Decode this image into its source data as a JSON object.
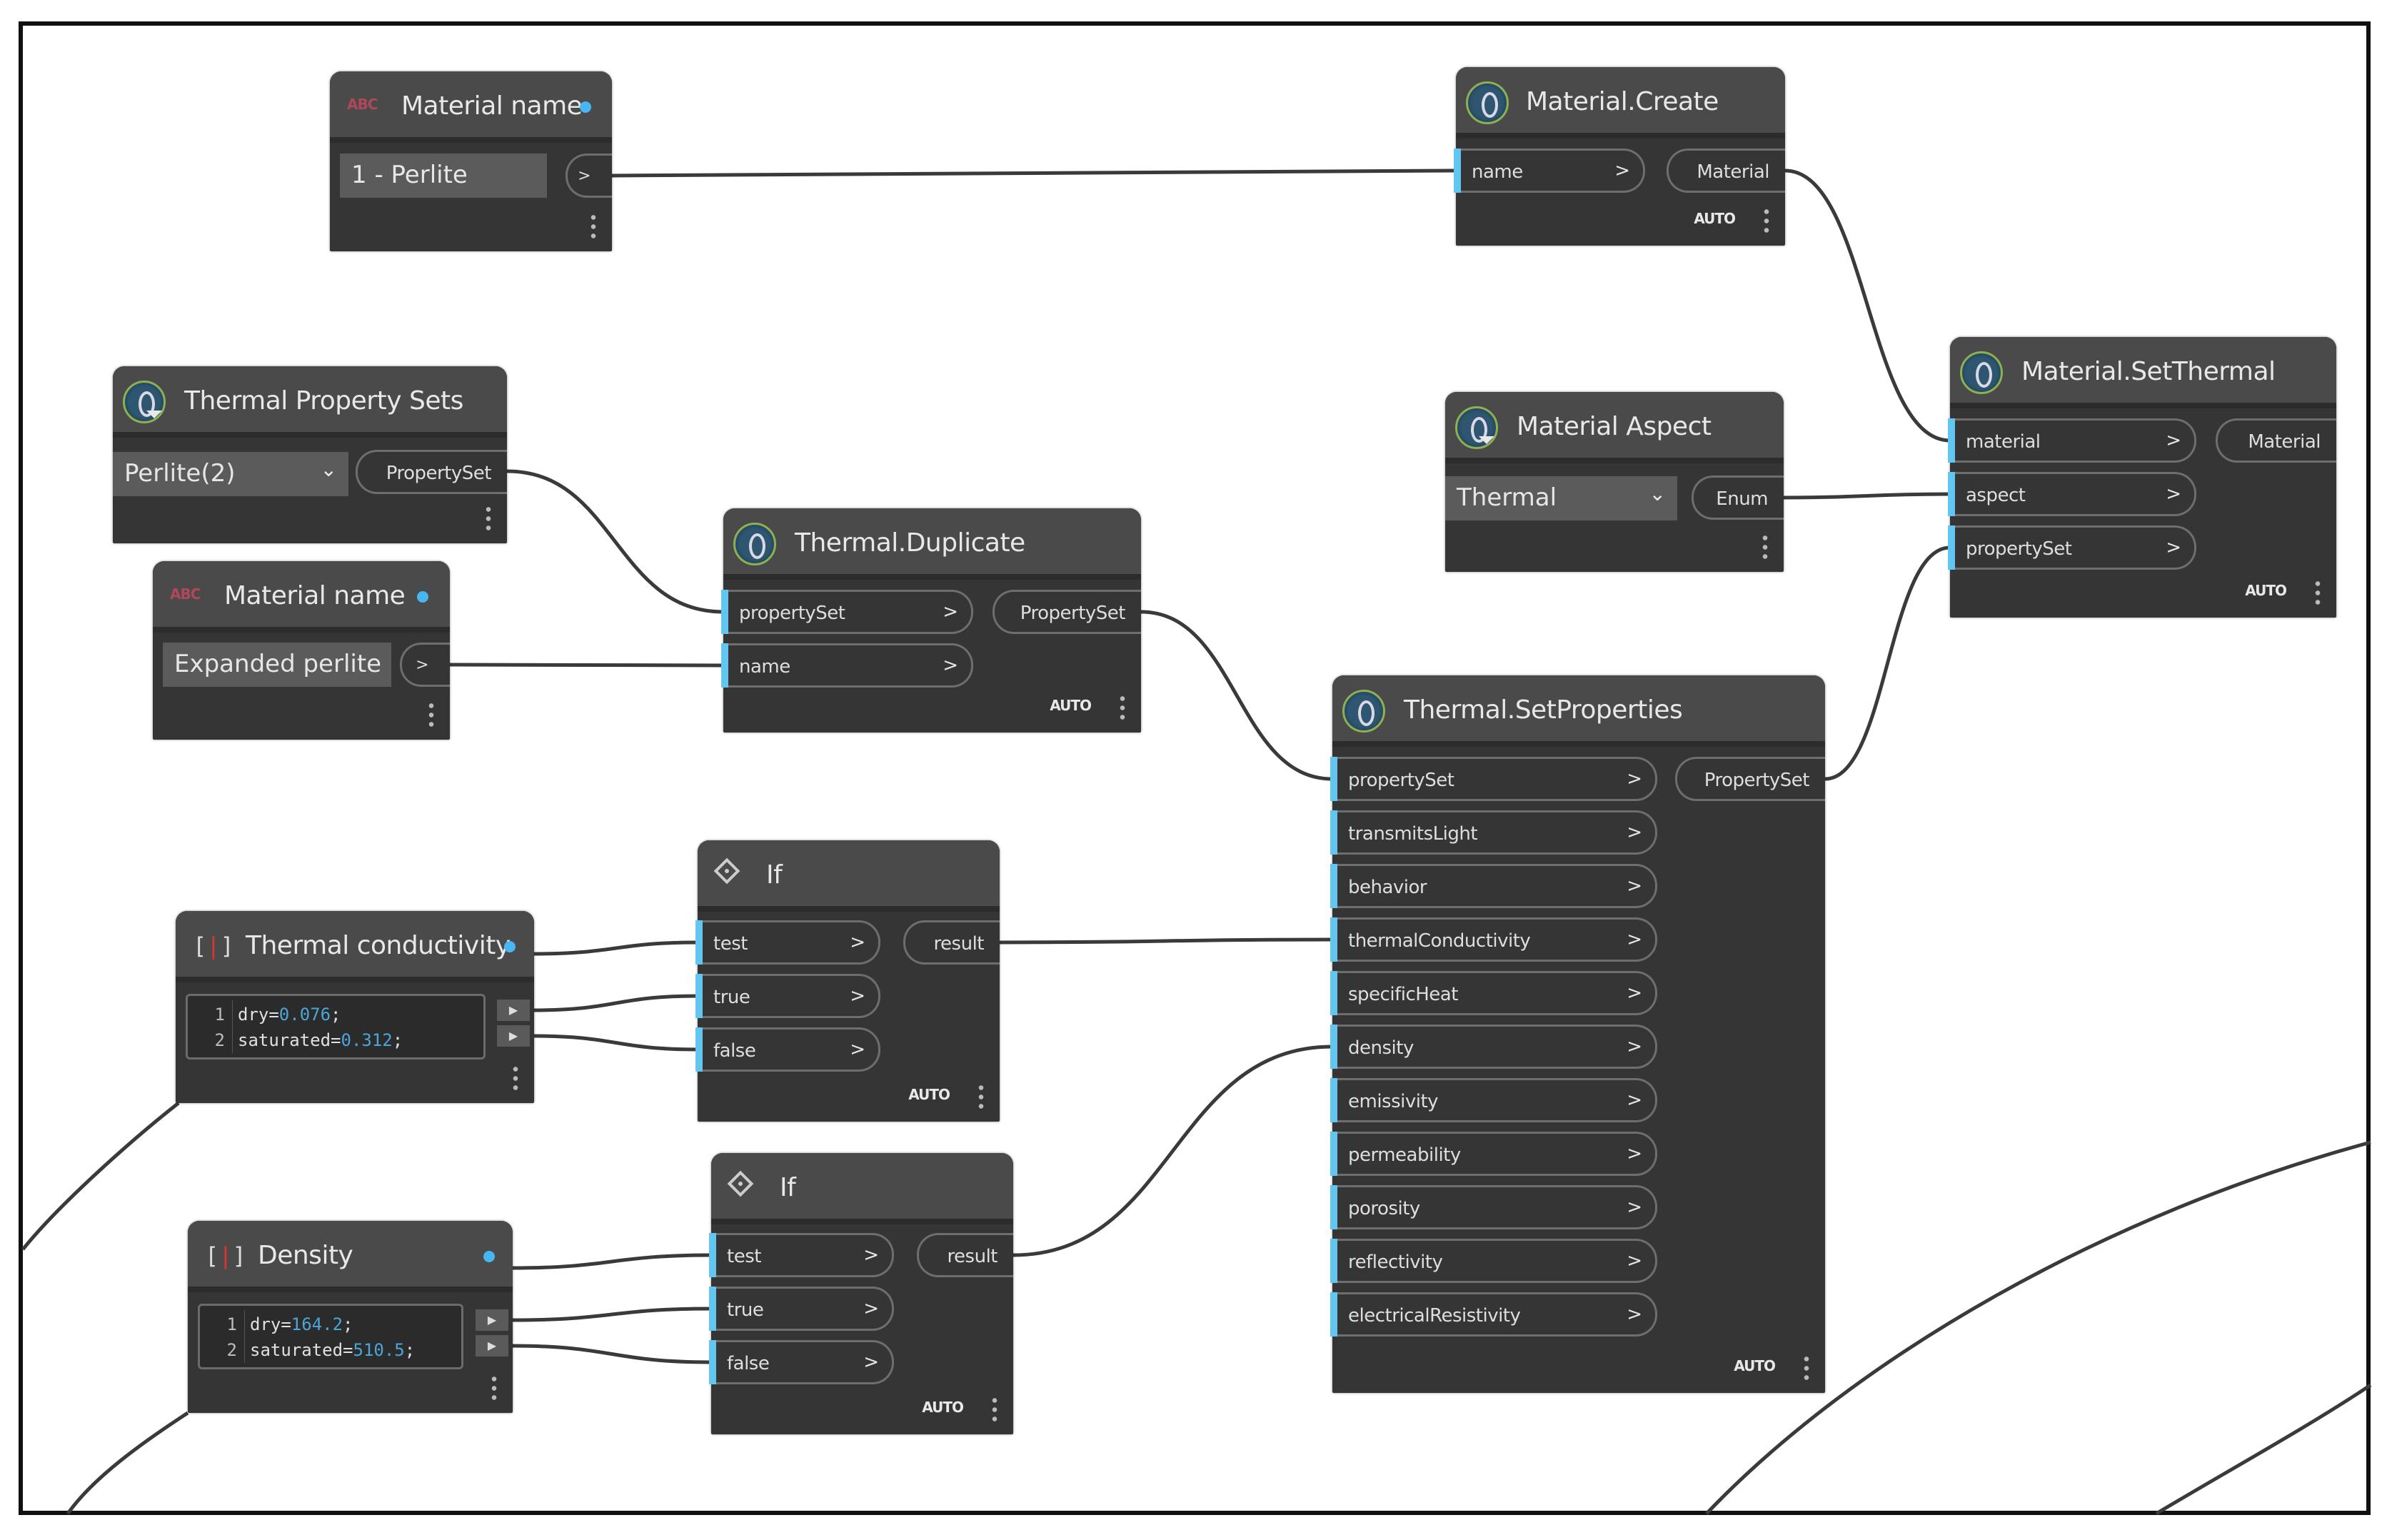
{
  "canvas": {
    "background": "#ffffff",
    "node_color": "#353535",
    "port_accent": "#63c6f0",
    "wire_color": "#3a3a3a"
  },
  "nodes": {
    "material_name_1": {
      "title": "Material name",
      "icon": "abc-string-icon",
      "value": "1 - Perlite",
      "output_chevron": ">"
    },
    "material_create": {
      "title": "Material.Create",
      "inputs": [
        {
          "label": "name",
          "chevron": ">"
        }
      ],
      "output": "Material",
      "lacing": "AUTO"
    },
    "thermal_property_sets": {
      "title": "Thermal Property Sets",
      "selected": "Perlite(2)",
      "dropdown_icon": "⌄",
      "output": "PropertySet"
    },
    "material_name_2": {
      "title": "Material name",
      "icon": "abc-string-icon",
      "value": "Expanded perlite",
      "output_chevron": ">"
    },
    "thermal_duplicate": {
      "title": "Thermal.Duplicate",
      "inputs": [
        {
          "label": "propertySet",
          "chevron": ">"
        },
        {
          "label": "name",
          "chevron": ">"
        }
      ],
      "output": "PropertySet",
      "lacing": "AUTO"
    },
    "material_aspect": {
      "title": "Material Aspect",
      "selected": "Thermal",
      "dropdown_icon": "⌄",
      "output": "Enum"
    },
    "material_setthermal": {
      "title": "Material.SetThermal",
      "inputs": [
        {
          "label": "material",
          "chevron": ">"
        },
        {
          "label": "aspect",
          "chevron": ">"
        },
        {
          "label": "propertySet",
          "chevron": ">"
        }
      ],
      "output": "Material",
      "lacing": "AUTO"
    },
    "thermal_setproperties": {
      "title": "Thermal.SetProperties",
      "inputs": [
        {
          "label": "propertySet",
          "chevron": ">"
        },
        {
          "label": "transmitsLight",
          "chevron": ">"
        },
        {
          "label": "behavior",
          "chevron": ">"
        },
        {
          "label": "thermalConductivity",
          "chevron": ">"
        },
        {
          "label": "specificHeat",
          "chevron": ">"
        },
        {
          "label": "density",
          "chevron": ">"
        },
        {
          "label": "emissivity",
          "chevron": ">"
        },
        {
          "label": "permeability",
          "chevron": ">"
        },
        {
          "label": "porosity",
          "chevron": ">"
        },
        {
          "label": "reflectivity",
          "chevron": ">"
        },
        {
          "label": "electricalResistivity",
          "chevron": ">"
        }
      ],
      "output": "PropertySet",
      "lacing": "AUTO"
    },
    "thermal_conductivity": {
      "title": "Thermal conductivity",
      "code": [
        {
          "n": "1",
          "key": "dry=",
          "num": "0.076",
          "end": ";"
        },
        {
          "n": "2",
          "key": "saturated=",
          "num": "0.312",
          "end": ";"
        }
      ],
      "output_chevron": "▶"
    },
    "density": {
      "title": "Density",
      "code": [
        {
          "n": "1",
          "key": "dry=",
          "num": "164.2",
          "end": ";"
        },
        {
          "n": "2",
          "key": "saturated=",
          "num": "510.5",
          "end": ";"
        }
      ],
      "output_chevron": "▶"
    },
    "if_1": {
      "title": "If",
      "inputs": [
        {
          "label": "test",
          "chevron": ">"
        },
        {
          "label": "true",
          "chevron": ">"
        },
        {
          "label": "false",
          "chevron": ">"
        }
      ],
      "output": "result",
      "lacing": "AUTO"
    },
    "if_2": {
      "title": "If",
      "inputs": [
        {
          "label": "test",
          "chevron": ">"
        },
        {
          "label": "true",
          "chevron": ">"
        },
        {
          "label": "false",
          "chevron": ">"
        }
      ],
      "output": "result",
      "lacing": "AUTO"
    }
  },
  "connections": [
    {
      "from": "material_name_1.out",
      "to": "material_create.in0"
    },
    {
      "from": "material_create.out",
      "to": "material_setthermal.in0"
    },
    {
      "from": "material_aspect.out",
      "to": "material_setthermal.in1"
    },
    {
      "from": "thermal_setproperties.out",
      "to": "material_setthermal.in2"
    },
    {
      "from": "thermal_property_sets.out",
      "to": "thermal_duplicate.in0"
    },
    {
      "from": "material_name_2.out",
      "to": "thermal_duplicate.in1"
    },
    {
      "from": "thermal_duplicate.out",
      "to": "thermal_setproperties.in0"
    },
    {
      "from": "if_1.out",
      "to": "thermal_setproperties.in3"
    },
    {
      "from": "if_2.out",
      "to": "thermal_setproperties.in5"
    },
    {
      "from": "thermal_conductivity.hdr",
      "to": "if_1.in0"
    },
    {
      "from": "thermal_conductivity.out0",
      "to": "if_1.in1"
    },
    {
      "from": "thermal_conductivity.out1",
      "to": "if_1.in2"
    },
    {
      "from": "density.hdr",
      "to": "if_2.in0"
    },
    {
      "from": "density.out0",
      "to": "if_2.in1"
    },
    {
      "from": "density.out1",
      "to": "if_2.in2"
    }
  ]
}
